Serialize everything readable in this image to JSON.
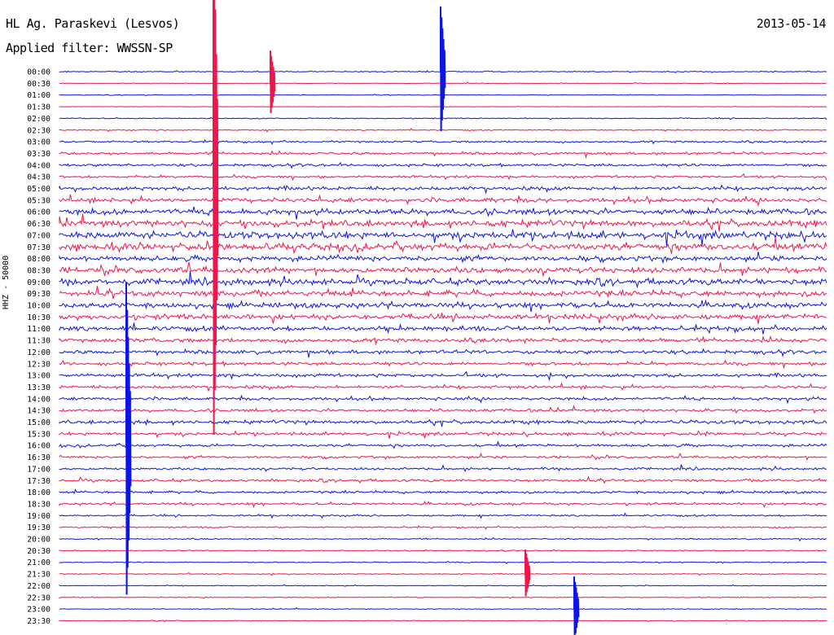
{
  "header": {
    "station": "HL Ag. Paraskevi (Lesvos)",
    "filter": "Applied filter: WWSSN-SP",
    "date": "2013-05-14"
  },
  "axis": {
    "channel_label": "HHZ - 50000"
  },
  "colors": {
    "trace_a": "#0a14e6",
    "trace_b": "#f0154a"
  },
  "chart_data": {
    "type": "line",
    "title": "",
    "ylabel": "HHZ - 50000",
    "y_ticks": [
      "00:00",
      "00:30",
      "01:00",
      "01:30",
      "02:00",
      "02:30",
      "03:00",
      "03:30",
      "04:00",
      "04:30",
      "05:00",
      "05:30",
      "06:00",
      "06:30",
      "07:00",
      "07:30",
      "08:00",
      "08:30",
      "09:00",
      "09:30",
      "10:00",
      "10:30",
      "11:00",
      "11:30",
      "12:00",
      "12:30",
      "13:00",
      "13:30",
      "14:00",
      "14:30",
      "15:00",
      "15:30",
      "16:00",
      "16:30",
      "17:00",
      "17:30",
      "18:00",
      "18:30",
      "19:00",
      "19:30",
      "20:00",
      "20:30",
      "21:00",
      "21:30",
      "22:00",
      "22:30",
      "23:00",
      "23:30"
    ],
    "trace_colors_alternate": [
      "blue",
      "red"
    ],
    "relative_noise_amplitude": [
      0.5,
      0.3,
      0.3,
      0.2,
      0.5,
      0.6,
      1.0,
      1.3,
      1.3,
      1.2,
      1.8,
      2.2,
      2.8,
      3.2,
      3.5,
      3.5,
      2.5,
      2.8,
      3.0,
      2.8,
      2.6,
      2.6,
      2.4,
      2.0,
      1.8,
      1.6,
      1.6,
      1.5,
      1.5,
      1.4,
      1.8,
      1.5,
      1.3,
      1.2,
      1.2,
      1.3,
      1.2,
      1.2,
      0.9,
      0.8,
      0.6,
      0.5,
      0.5,
      0.5,
      0.4,
      0.4,
      0.4,
      0.4
    ],
    "grid": false
  }
}
